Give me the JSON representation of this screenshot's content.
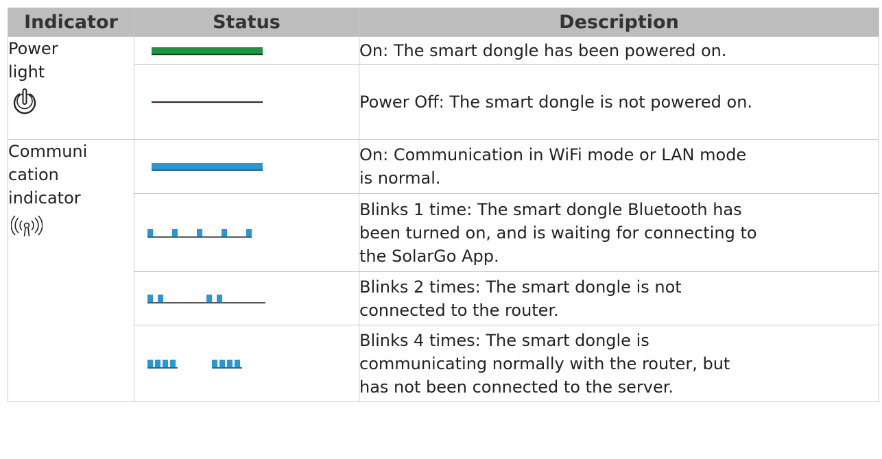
{
  "headers": {
    "indicator": "Indicator",
    "status": "Status",
    "description": "Description"
  },
  "power": {
    "name_line1": "Power",
    "name_line2": "light",
    "icon": "power-icon",
    "rows": [
      {
        "status_icon": "solid-green-bar",
        "color": "#119b3a",
        "description": "On: The smart dongle has been powered on."
      },
      {
        "status_icon": "off-line",
        "color": "#3a2a2a",
        "description": "Power Off: The smart dongle is not powered on."
      }
    ]
  },
  "communication": {
    "name_line1": "Communi",
    "name_line2": "cation",
    "name_line3": "indicator",
    "icon": "wireless-signal-icon",
    "rows": [
      {
        "status_icon": "solid-blue-bar",
        "color": "#1e9ae0",
        "description_line1": "On: Communication in WiFi mode or LAN mode",
        "description_line2": "is normal."
      },
      {
        "status_icon": "blink-1-pattern",
        "color": "#1e9ae0",
        "description_line1": "Blinks 1 time: The smart dongle Bluetooth has",
        "description_line2": "been turned on, and is waiting for connecting to",
        "description_line3": "the SolarGo App."
      },
      {
        "status_icon": "blink-2-pattern",
        "color": "#1e9ae0",
        "description_line1": "Blinks 2 times: The smart dongle is not",
        "description_line2": "connected to the router."
      },
      {
        "status_icon": "blink-4-pattern",
        "color": "#1e9ae0",
        "description_line1": "Blinks 4 times: The smart dongle is",
        "description_line2": "communicating normally with the router, but",
        "description_line3": "has not been connected to the server."
      }
    ]
  }
}
